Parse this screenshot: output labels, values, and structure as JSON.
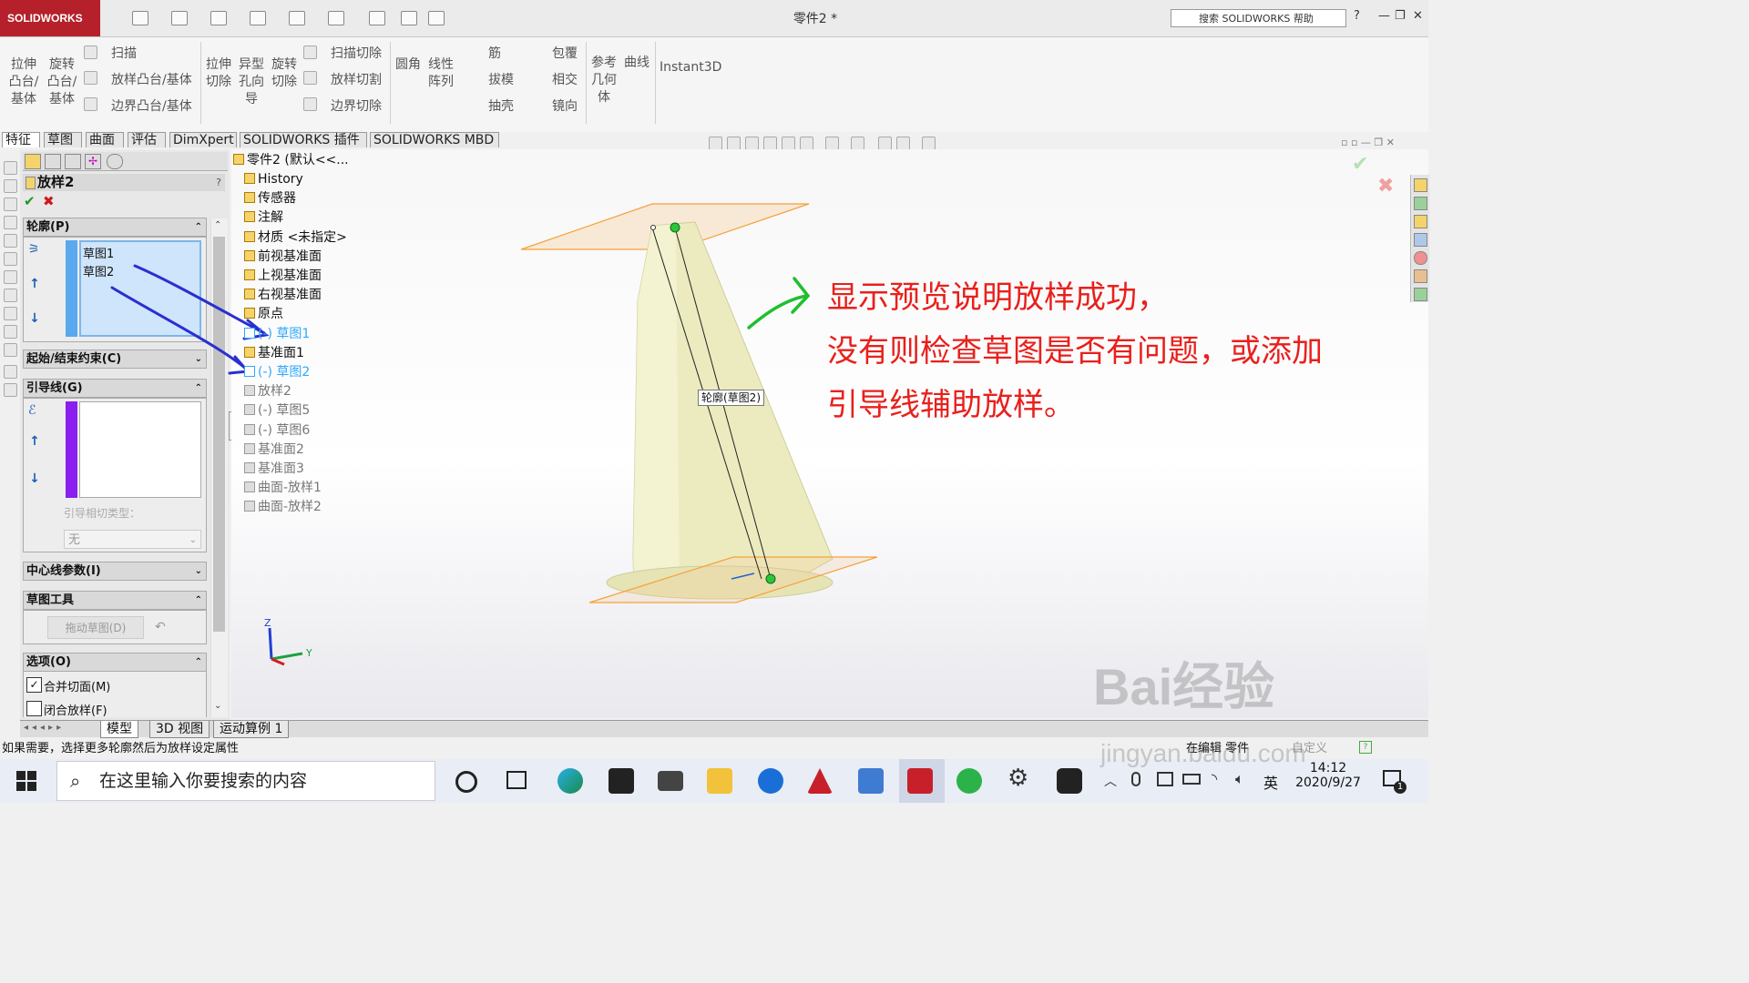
{
  "titlebar": {
    "logo": "SOLIDWORKS",
    "doc_title": "零件2 *",
    "search_placeholder": "搜索 SOLIDWORKS 帮助",
    "help": "?"
  },
  "commands": {
    "extrude_boss": "拉伸\n凸台/\n基体",
    "revolve_boss": "旋转\n凸台/\n基体",
    "sweep": "扫描",
    "loft_boss": "放样凸台/基体",
    "boundary_boss": "边界凸台/基体",
    "extrude_cut": "拉伸\n切除",
    "hole_wizard": "异型\n孔向\n导",
    "revolve_cut": "旋转\n切除",
    "swept_cut": "扫描切除",
    "lofted_cut": "放样切割",
    "boundary_cut": "边界切除",
    "fillet": "圆角",
    "linear_pattern": "线性\n阵列",
    "rib": "筋",
    "draft": "拔模",
    "shell": "抽壳",
    "wrap": "包覆",
    "intersect": "相交",
    "mirror": "镜向",
    "ref_geometry": "参考\n几何\n体",
    "curves": "曲线",
    "instant3d": "Instant3D"
  },
  "tabs": [
    "特征",
    "草图",
    "曲面",
    "评估",
    "DimXpert",
    "SOLIDWORKS 插件",
    "SOLIDWORKS MBD"
  ],
  "property_manager": {
    "title": "放样2",
    "profiles_header": "轮廓(P)",
    "profiles": [
      "草图1",
      "草图2"
    ],
    "start_end_header": "起始/结束约束(C)",
    "guides_header": "引导线(G)",
    "guide_tangency_label": "引导相切类型：",
    "guide_tangency_value": "无",
    "centerline_header": "中心线参数(I)",
    "sketch_tools_header": "草图工具",
    "drag_sketch": "拖动草图(D)",
    "options_header": "选项(O)",
    "merge_tangent": "合并切面(M)",
    "merge_tangent_checked": true,
    "close_loft": "闭合放样(F)",
    "close_loft_checked": false
  },
  "tree": {
    "root": "零件2  (默认<<...",
    "items": [
      {
        "label": "History",
        "style": "normal"
      },
      {
        "label": "传感器",
        "style": "normal"
      },
      {
        "label": "注解",
        "style": "normal"
      },
      {
        "label": "材质 <未指定>",
        "style": "normal"
      },
      {
        "label": "前视基准面",
        "style": "normal"
      },
      {
        "label": "上视基准面",
        "style": "normal"
      },
      {
        "label": "右视基准面",
        "style": "normal"
      },
      {
        "label": "原点",
        "style": "normal"
      },
      {
        "label": "(-) 草图1",
        "style": "blue"
      },
      {
        "label": "基准面1",
        "style": "normal"
      },
      {
        "label": "(-) 草图2",
        "style": "blue"
      },
      {
        "label": "放样2",
        "style": "dim"
      },
      {
        "label": "(-) 草图5",
        "style": "dim"
      },
      {
        "label": "(-) 草图6",
        "style": "dim"
      },
      {
        "label": "基准面2",
        "style": "dim"
      },
      {
        "label": "基准面3",
        "style": "dim"
      },
      {
        "label": "曲面-放样1",
        "style": "dim"
      },
      {
        "label": "曲面-放样2",
        "style": "dim"
      }
    ]
  },
  "viewport": {
    "callout": "轮廓(草图2)",
    "annotation_lines": [
      "显示预览说明放样成功，",
      "没有则检查草图是否有问题，或添加",
      "引导线辅助放样。"
    ],
    "axis_z": "Z",
    "axis_y": "Y"
  },
  "bottom_tabs": [
    "模型",
    "3D 视图",
    "运动算例 1"
  ],
  "status": {
    "message": "如果需要，选择更多轮廓然后为放样设定属性",
    "mode": "在编辑 零件",
    "custom": "自定义"
  },
  "taskbar": {
    "search_placeholder": "在这里输入你要搜索的内容",
    "ime": "英",
    "time": "14:12",
    "date": "2020/9/27",
    "notifications": "1"
  },
  "watermark": {
    "brand": "Bai经验",
    "url": "jingyan.baidu.com"
  },
  "colors": {
    "accent_red": "#e8201c",
    "sw_red": "#b5202a",
    "blue_item": "#2fa8ff",
    "loft_fill": "#f1efc0",
    "plane_orange": "#f5a23a"
  }
}
